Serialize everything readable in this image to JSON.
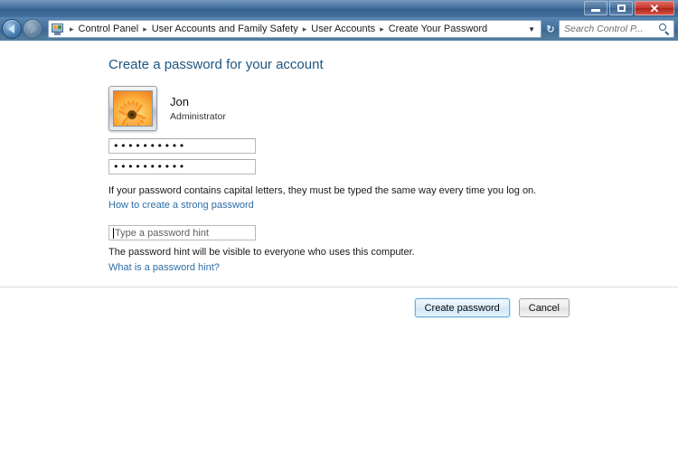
{
  "window": {
    "controls": {
      "minimize_label": "Minimize",
      "maximize_label": "Maximize",
      "close_label": "✕"
    }
  },
  "addressbar": {
    "back_label": "Back",
    "forward_label": "Forward",
    "icon": "control-panel-icon",
    "breadcrumbs": [
      "Control Panel",
      "User Accounts and Family Safety",
      "User Accounts",
      "Create Your Password"
    ],
    "separator": "▸",
    "dropdown_glyph": "▼",
    "refresh_glyph": "↻",
    "search": {
      "placeholder": "Search Control P...",
      "icon": "search-icon"
    }
  },
  "main": {
    "page_title": "Create a password for your account",
    "user": {
      "name": "Jon",
      "role": "Administrator",
      "avatar_icon": "flower-avatar"
    },
    "password_field": {
      "value_dots": "••••••••••",
      "char_count": 10
    },
    "confirm_field": {
      "value_dots": "••••••••••",
      "char_count": 10
    },
    "caps_note": "If your password contains capital letters, they must be typed the same way every time you log on.",
    "strong_password_link": "How to create a strong password",
    "hint_field": {
      "value": "",
      "placeholder": "Type a password hint"
    },
    "hint_note": "The password hint will be visible to everyone who uses this computer.",
    "hint_link": "What is a password hint?"
  },
  "footer": {
    "create_label": "Create password",
    "cancel_label": "Cancel"
  },
  "colors": {
    "titlebar": "#3c6b9c",
    "heading": "#1f5580",
    "link": "#2d6ea8",
    "close_button": "#c33a2e",
    "default_button_border": "#6fb0d8"
  }
}
